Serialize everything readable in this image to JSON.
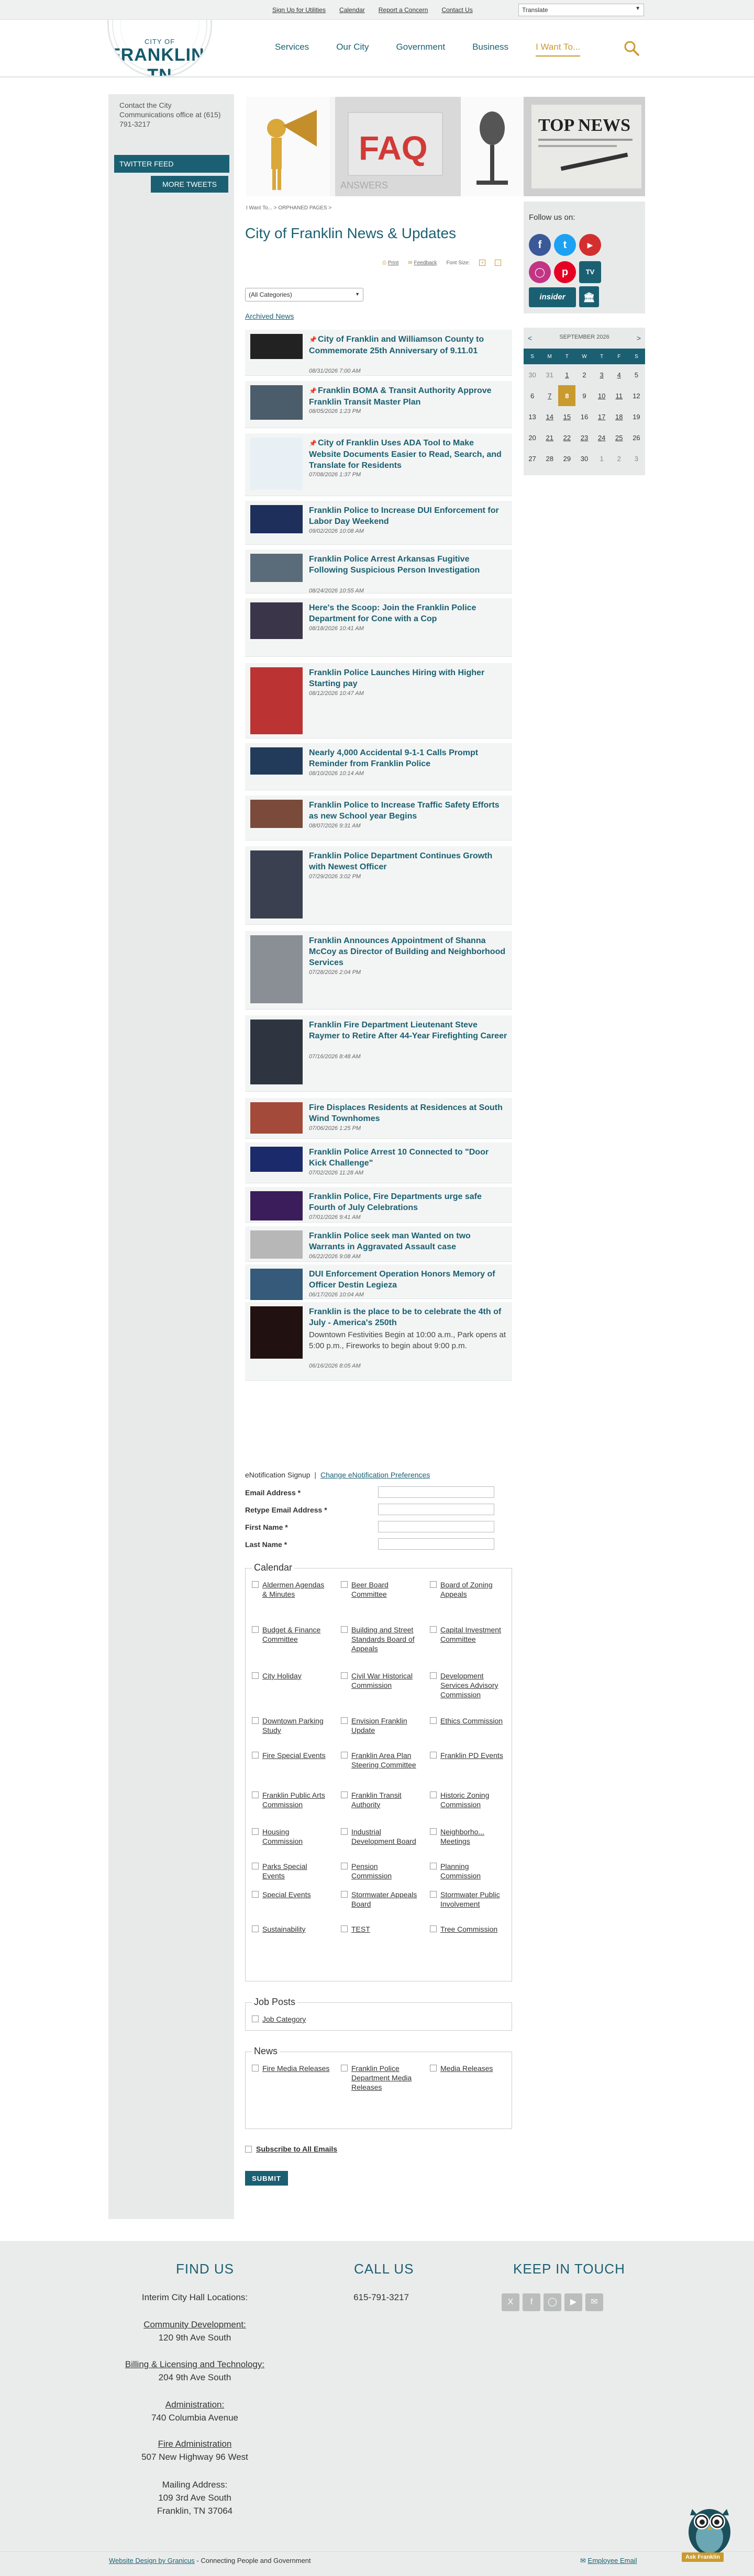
{
  "topbar": {
    "links": [
      "Sign Up for Utilities",
      "Calendar",
      "Report a Concern",
      "Contact Us"
    ],
    "translate_label": "Translate"
  },
  "header": {
    "logo_small": "CITY OF",
    "logo_big": "FRANKLIN, TN",
    "nav": [
      "Services",
      "Our City",
      "Government",
      "Business",
      "I Want To..."
    ]
  },
  "sidebar": {
    "contact": "Contact the City Communications office at (615) 791-3217",
    "twitter_feed": "TWITTER FEED",
    "more_tweets": "MORE TWEETS"
  },
  "banner": {
    "faq": "FAQ",
    "answers": "ANSWERS",
    "top_news": "TOP NEWS"
  },
  "page": {
    "breadcrumb": "I Want To... > ORPHANED PAGES >",
    "title": "City of Franklin News & Updates",
    "tools": {
      "print": "Print",
      "feedback": "Feedback",
      "font_size": "Font Size:"
    },
    "category_select": "(All Categories)",
    "archived": "Archived News"
  },
  "news": [
    {
      "title": "City of Franklin and Williamson County to Commemorate 25th Anniversary of 9.11.01",
      "date": "08/31/2026 7:00 AM",
      "pinned": true
    },
    {
      "title": "Franklin BOMA & Transit Authority Approve Franklin Transit Master Plan",
      "date": "08/05/2026 1:23 PM",
      "pinned": true
    },
    {
      "title": "City of Franklin Uses ADA Tool to Make Website Documents Easier to Read, Search, and Translate for Residents",
      "date": "07/08/2026 1:37 PM",
      "pinned": true
    },
    {
      "title": "Franklin Police to Increase DUI Enforcement for Labor Day Weekend",
      "date": "09/02/2026 10:08 AM",
      "pinned": false
    },
    {
      "title": "Franklin Police Arrest Arkansas Fugitive Following Suspicious Person Investigation",
      "date": "08/24/2026 10:55 AM",
      "pinned": false
    },
    {
      "title": "Here's the Scoop: Join the Franklin Police Department for Cone with a Cop",
      "date": "08/18/2026 10:41 AM",
      "pinned": false
    },
    {
      "title": "Franklin Police Launches Hiring with Higher Starting pay",
      "date": "08/12/2026 10:47 AM",
      "pinned": false
    },
    {
      "title": "Nearly 4,000 Accidental 9-1-1 Calls Prompt Reminder from Franklin Police",
      "date": "08/10/2026 10:14 AM",
      "pinned": false
    },
    {
      "title": "Franklin Police to Increase Traffic Safety Efforts as new School year Begins",
      "date": "08/07/2026 9:31 AM",
      "pinned": false
    },
    {
      "title": "Franklin Police Department Continues Growth with Newest Officer",
      "date": "07/29/2026 3:02 PM",
      "pinned": false
    },
    {
      "title": "Franklin Announces Appointment of Shanna McCoy as Director of Building and Neighborhood Services",
      "date": "07/28/2026 2:04 PM",
      "pinned": false
    },
    {
      "title": "Franklin Fire Department Lieutenant Steve Raymer to Retire After 44-Year Firefighting Career",
      "date": "07/16/2026 8:48 AM",
      "pinned": false
    },
    {
      "title": "Fire Displaces Residents at Residences at South Wind Townhomes",
      "date": "07/06/2026 1:25 PM",
      "pinned": false
    },
    {
      "title": "Franklin Police Arrest 10 Connected to \"Door Kick Challenge\"",
      "date": "07/02/2026 11:28 AM",
      "pinned": false
    },
    {
      "title": "Franklin Police, Fire Departments urge safe Fourth of July Celebrations",
      "date": "07/01/2026 9:41 AM",
      "pinned": false
    },
    {
      "title": "Franklin Police seek man Wanted on two Warrants in Aggravated Assault case",
      "date": "06/22/2026 9:08 AM",
      "pinned": false
    },
    {
      "title": "DUI Enforcement Operation Honors Memory of Officer Destin Legieza",
      "date": "06/17/2026 10:04 AM",
      "pinned": false
    },
    {
      "title": "Franklin is the place to be to celebrate the 4th of July - America's 250th",
      "date": "06/16/2026 8:05 AM",
      "pinned": false,
      "desc": "Downtown Festivities Begin at 10:00 a.m., Park opens at 5:00 p.m., Fireworks to begin about 9:00 p.m."
    }
  ],
  "follow": {
    "label": "Follow us on:",
    "insider": "insider",
    "tv": "TV"
  },
  "calendar": {
    "month": "SEPTEMBER 2026",
    "prev": "<",
    "next": ">",
    "days": [
      "S",
      "M",
      "T",
      "W",
      "T",
      "F",
      "S"
    ],
    "weeks": [
      [
        "30",
        "31",
        "1",
        "2",
        "3",
        "4",
        "5"
      ],
      [
        "6",
        "7",
        "8",
        "9",
        "10",
        "11",
        "12"
      ],
      [
        "13",
        "14",
        "15",
        "16",
        "17",
        "18",
        "19"
      ],
      [
        "20",
        "21",
        "22",
        "23",
        "24",
        "25",
        "26"
      ],
      [
        "27",
        "28",
        "29",
        "30",
        "1",
        "2",
        "3"
      ]
    ],
    "today": "8",
    "with_events": [
      "1",
      "3",
      "4",
      "7",
      "10",
      "11",
      "14",
      "15",
      "17",
      "18",
      "21",
      "22",
      "23",
      "24",
      "25"
    ]
  },
  "enotification": {
    "signup": "eNotification Signup",
    "separator": "|",
    "change": "Change eNotification Preferences",
    "fields": [
      "Email Address *",
      "Retype Email Address *",
      "First Name *",
      "Last Name *"
    ]
  },
  "groups": [
    {
      "legend": "Calendar",
      "items": [
        "Aldermen Agendas & Minutes",
        "Beer Board Committee",
        "Board of Zoning Appeals",
        "Budget & Finance Committee",
        "Building and Street Standards Board of Appeals",
        "Capital Investment Committee",
        "City Holiday",
        "Civil War Historical Commission",
        "Development Services Advisory Commission",
        "Downtown Parking Study",
        "Envision Franklin Update",
        "Ethics Commission",
        "Fire Special Events",
        "Franklin Area Plan Steering Committee",
        "Franklin PD Events",
        "Franklin Public Arts Commission",
        "Franklin Transit Authority",
        "Historic Zoning Commission",
        "Housing Commission",
        "Industrial Development Board",
        "Neighborho... Meetings",
        "Parks Special Events",
        "Pension Commission",
        "Planning Commission",
        "Special Events",
        "Stormwater Appeals Board",
        "Stormwater Public Involvement",
        "Sustainability",
        "TEST",
        "Tree Commission"
      ]
    },
    {
      "legend": "Job Posts",
      "items": [
        "Job Category"
      ]
    },
    {
      "legend": "News",
      "items": [
        "Fire Media Releases",
        "Franklin Police Department Media Releases",
        "Media Releases"
      ]
    }
  ],
  "subscribe_all": "Subscribe to All Emails",
  "submit": "SUBMIT",
  "footer": {
    "find_us": "FIND US",
    "call_us": "CALL US",
    "keep_in_touch": "KEEP IN TOUCH",
    "phone": "615-791-3217",
    "interim": "Interim City Hall Locations:",
    "locations": [
      {
        "label": "Community Development:",
        "address": "120 9th Ave South"
      },
      {
        "label": "Billing & Licensing and Technology:",
        "address": "204 9th Ave South"
      },
      {
        "label": "Administration:",
        "address": "740 Columbia Avenue"
      },
      {
        "label": "Fire Administration",
        "address": "507 New Highway 96 West"
      }
    ],
    "mailing_label": "Mailing Address:",
    "mailing_line1": "109 3rd Ave South",
    "mailing_line2": "Franklin, TN 37064",
    "credit_prefix": "Website Design by Granicus",
    "credit_suffix": " - Connecting People and Government",
    "employee_email": "Employee Email",
    "ask_franklin": "Ask Franklin"
  }
}
